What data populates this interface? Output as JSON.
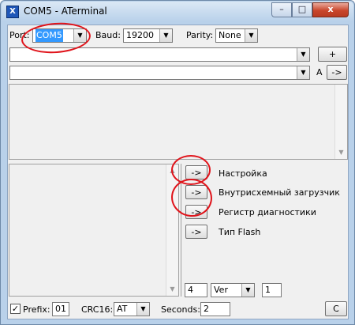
{
  "window": {
    "title": "COM5 - ATerminal",
    "icon": "aterminal-app-icon",
    "controls": {
      "minimize": "–",
      "maximize": "□",
      "close": "x"
    }
  },
  "toolbar": {
    "port_label": "Port:",
    "port_value": "COM5",
    "baud_label": "Baud:",
    "baud_value": "19200",
    "parity_label": "Parity:",
    "parity_value": "None"
  },
  "command_row1": {
    "value": "",
    "add_button": "+"
  },
  "command_row2": {
    "value": "",
    "a_label": "A",
    "send_button": "->"
  },
  "commands": [
    {
      "button": "->",
      "label": "Настройка"
    },
    {
      "button": "->",
      "label": "Внутрисхемный загрузчик"
    },
    {
      "button": "->",
      "label": "Регистр диагностики"
    },
    {
      "button": "->",
      "label": "Тип Flash"
    }
  ],
  "bottom_controls": {
    "count_value": "4",
    "mode_value": "Ver",
    "param_value": "1"
  },
  "footer": {
    "prefix_checked": true,
    "prefix_label": "Prefix:",
    "prefix_value": "01",
    "crc_label": "CRC16:",
    "crc_value": "AT",
    "seconds_label": "Seconds:",
    "seconds_value": "2",
    "clear_button": "C"
  },
  "colors": {
    "annotation_circle": "#e0141b",
    "selection": "#3399ff",
    "close_button": "#c9462c"
  }
}
